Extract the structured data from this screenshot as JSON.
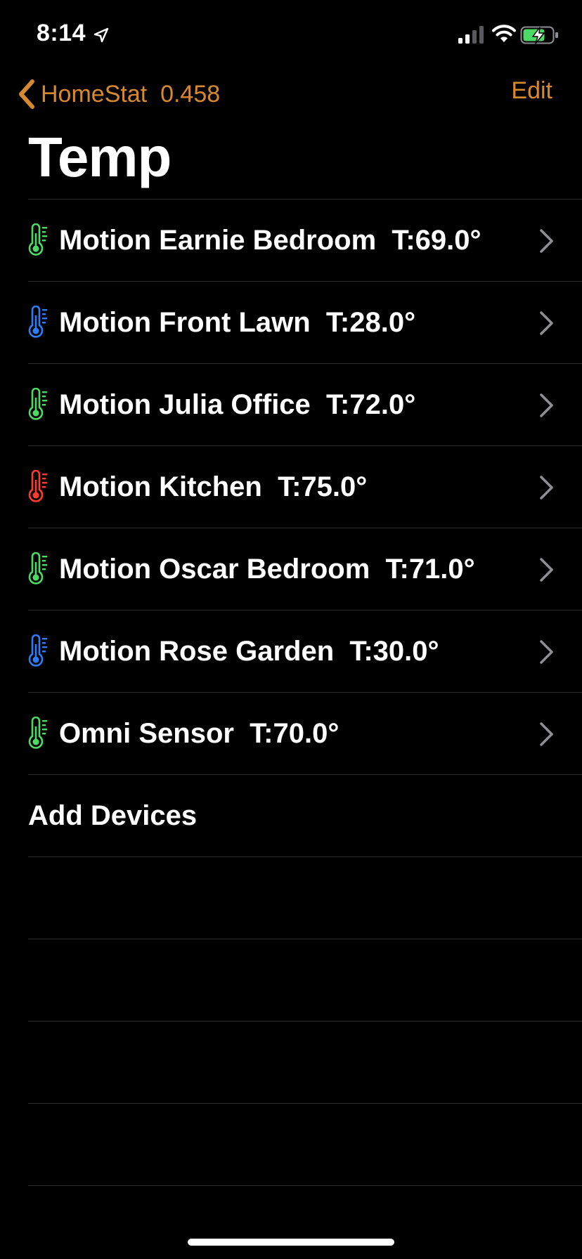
{
  "status_bar": {
    "time": "8:14",
    "icons": [
      "location-arrow-icon",
      "cellular-signal-icon",
      "wifi-icon",
      "battery-charging-icon"
    ]
  },
  "nav": {
    "back_label": "HomeStat  0.458",
    "edit_label": "Edit",
    "title": "Temp"
  },
  "colors": {
    "accent": "#d6892f",
    "thermo_green": "#4cd964",
    "thermo_blue": "#2f7cf6",
    "thermo_red": "#ff3b30",
    "separator": "#2a2a2c",
    "chevron": "#8e8e93"
  },
  "devices": [
    {
      "label": "Motion Earnie Bedroom  T:69.0°",
      "icon": "thermometer-green-icon",
      "status": "green"
    },
    {
      "label": "Motion Front Lawn  T:28.0°",
      "icon": "thermometer-blue-icon",
      "status": "blue"
    },
    {
      "label": "Motion Julia Office  T:72.0°",
      "icon": "thermometer-green-icon",
      "status": "green"
    },
    {
      "label": "Motion Kitchen  T:75.0°",
      "icon": "thermometer-red-icon",
      "status": "red"
    },
    {
      "label": "Motion Oscar Bedroom  T:71.0°",
      "icon": "thermometer-green-icon",
      "status": "green"
    },
    {
      "label": "Motion Rose Garden  T:30.0°",
      "icon": "thermometer-blue-icon",
      "status": "blue"
    },
    {
      "label": "Omni Sensor  T:70.0°",
      "icon": "thermometer-green-icon",
      "status": "green"
    }
  ],
  "add_devices_label": "Add Devices"
}
